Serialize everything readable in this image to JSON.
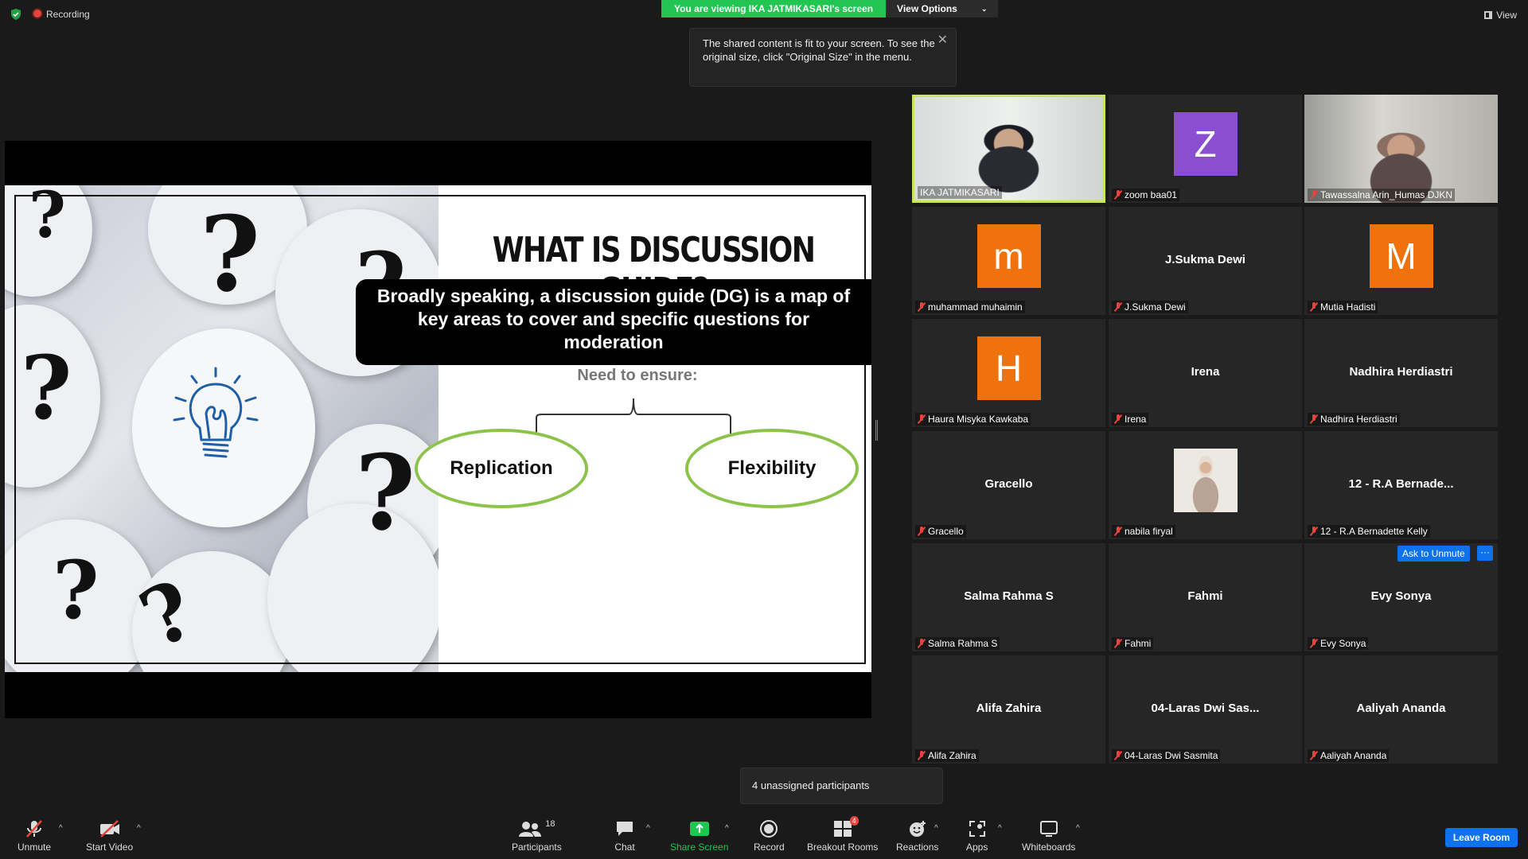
{
  "top": {
    "recording_label": "Recording",
    "viewing_banner": "You are viewing IKA JATMIKASARI's screen",
    "view_options": "View Options",
    "view_label": "View"
  },
  "tooltip": {
    "text": "The shared content is fit to your screen. To see the original size, click \"Original Size\" in the menu."
  },
  "slide": {
    "title": "WHAT IS DISCUSSION GUIDE?",
    "box_text": "Broadly speaking, a discussion guide (DG) is a map of key areas to cover and specific questions for moderation",
    "need": "Need to ensure:",
    "left_oval": "Replication",
    "right_oval": "Flexibility"
  },
  "participants": [
    {
      "name": "IKA JATMIKASARI",
      "type": "video",
      "active": true
    },
    {
      "name": "zoom baa01",
      "type": "avatar",
      "initial": "Z",
      "color": "#8a4fd0"
    },
    {
      "name": "Tawassalna Arin_Humas DJKN",
      "type": "video"
    },
    {
      "name": "muhammad muhaimin",
      "type": "avatar",
      "initial": "m",
      "color": "#f0720c"
    },
    {
      "name": "J.Sukma Dewi",
      "type": "text",
      "big": "J.Sukma Dewi"
    },
    {
      "name": "Mutia Hadisti",
      "type": "avatar",
      "initial": "M",
      "color": "#f0720c"
    },
    {
      "name": "Haura Misyka Kawkaba",
      "type": "avatar",
      "initial": "H",
      "color": "#f0720c"
    },
    {
      "name": "Irena",
      "type": "text",
      "big": "Irena"
    },
    {
      "name": "Nadhira Herdiastri",
      "type": "text",
      "big": "Nadhira Herdiastri"
    },
    {
      "name": "Gracello",
      "type": "text",
      "big": "Gracello"
    },
    {
      "name": "nabila firyal",
      "type": "photo"
    },
    {
      "name": "12 - R.A Bernadette Kelly",
      "type": "text",
      "big": "12 - R.A Bernade..."
    },
    {
      "name": "Salma Rahma S",
      "type": "text",
      "big": "Salma Rahma S"
    },
    {
      "name": "Fahmi",
      "type": "text",
      "big": "Fahmi"
    },
    {
      "name": "Evy Sonya",
      "type": "text",
      "big": "Evy Sonya"
    },
    {
      "name": "Alifa Zahira",
      "type": "text",
      "big": "Alifa Zahira"
    },
    {
      "name": "04-Laras Dwi Sasmita",
      "type": "text",
      "big": "04-Laras Dwi Sas..."
    },
    {
      "name": "Aaliyah Ananda",
      "type": "text",
      "big": "Aaliyah Ananda"
    }
  ],
  "ask_unmute": "Ask to Unmute",
  "more": "···",
  "unassigned": "4 unassigned participants",
  "toolbar": {
    "unmute": "Unmute",
    "start_video": "Start Video",
    "participants": "Participants",
    "participants_count": "18",
    "chat": "Chat",
    "share_screen": "Share Screen",
    "record": "Record",
    "breakout_rooms": "Breakout Rooms",
    "breakout_badge": "4",
    "reactions": "Reactions",
    "apps": "Apps",
    "whiteboards": "Whiteboards",
    "leave_room": "Leave Room"
  }
}
